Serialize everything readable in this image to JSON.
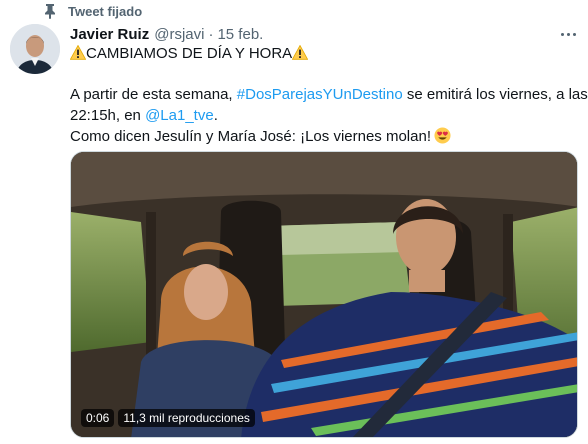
{
  "pinned": {
    "label": "Tweet fijado",
    "icon": "pin-icon"
  },
  "author": {
    "name": "Javier Ruiz",
    "handle": "@rsjavi",
    "separator": "·",
    "date": "15 feb."
  },
  "tweet": {
    "line1": "CAMBIAMOS DE DÍA Y HORA",
    "line2_a": "A partir de esta semana, ",
    "hashtag": "#DosParejasYUnDestino",
    "line2_b": " se emitirá los viernes, a las",
    "line3_a": "22:15h, en ",
    "mention": "@La1_tve",
    "line3_b": ".",
    "line4": "Como dicen Jesulín y María José: ¡Los viernes molan!",
    "icons": [
      "warning-emoji-icon",
      "heart-eyes-emoji-icon"
    ]
  },
  "video": {
    "time": "0:06",
    "views": "11,3 mil reproducciones"
  },
  "colors": {
    "link": "#1d9bf0",
    "secondary": "#536471",
    "text": "#0f1419"
  }
}
